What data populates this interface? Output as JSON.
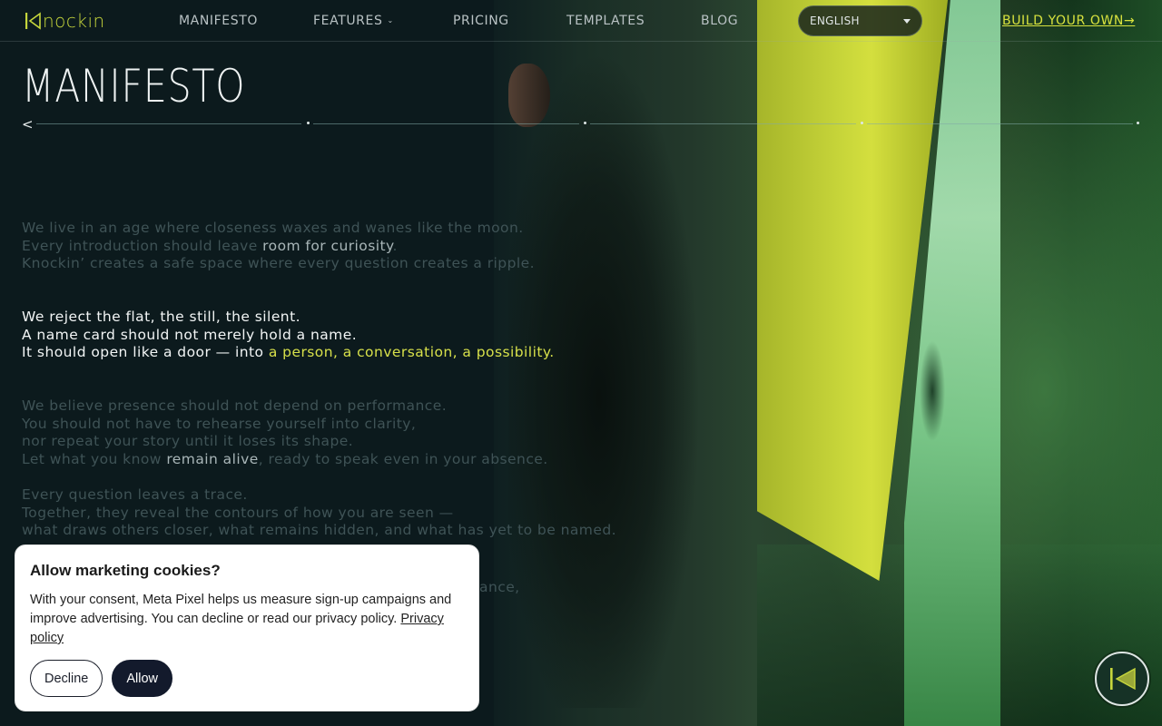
{
  "brand": {
    "logo_text": "nockin",
    "accent": "#c6d63c"
  },
  "nav": {
    "items": [
      {
        "label": "MANIFESTO"
      },
      {
        "label": "FEATURES",
        "has_dropdown": true
      },
      {
        "label": "PRICING"
      },
      {
        "label": "TEMPLATES"
      },
      {
        "label": "BLOG"
      }
    ],
    "language": {
      "selected": "ENGLISH"
    },
    "cta": "BUILD YOUR OWN→"
  },
  "manifesto": {
    "title": "MANIFESTO",
    "back": "<",
    "progress_sections": 4,
    "stanza1": {
      "l1": "We live in an age where closeness waxes and wanes like the moon.",
      "l2a": "Every introduction should leave ",
      "l2b": "room for curiosity",
      "l2c": ".",
      "l3": "Knockin’ creates a safe space where every question creates a ripple."
    },
    "stanza2": {
      "l1": "We reject the flat, the still, the silent.",
      "l2": "A name card should not merely hold a name.",
      "l3a": "It should open like a door — into ",
      "l3b": "a person, a conversation, a possibility."
    },
    "stanza3": {
      "l1": "We believe presence should not depend on performance.",
      "l2": "You should not have to rehearse yourself into clarity,",
      "l3": "nor repeat your story until it loses its shape.",
      "l4a": "Let what you know ",
      "l4b": "remain alive",
      "l4c": ", ready to speak even in your absence."
    },
    "stanza4": {
      "l1": "Every question leaves a trace.",
      "l2": "Together, they reveal the contours of how you are seen —",
      "l3": "what draws others closer, what remains hidden, and what has yet to be named."
    },
    "stanza5": {
      "l1": "ance,"
    }
  },
  "cookie_dialog": {
    "title": "Allow marketing cookies?",
    "body": "With your consent, Meta Pixel helps us measure sign-up campaigns and improve advertising. You can decline or read our privacy policy.",
    "privacy_link": "Privacy policy",
    "decline": "Decline",
    "allow": "Allow"
  },
  "floating_button": {
    "icon": "knockin-logo-icon"
  },
  "colors": {
    "background": "#0c1a1d",
    "accent_yellow": "#d7e04a",
    "dim_text": "#3f5356",
    "button_dark": "#131a2c"
  }
}
